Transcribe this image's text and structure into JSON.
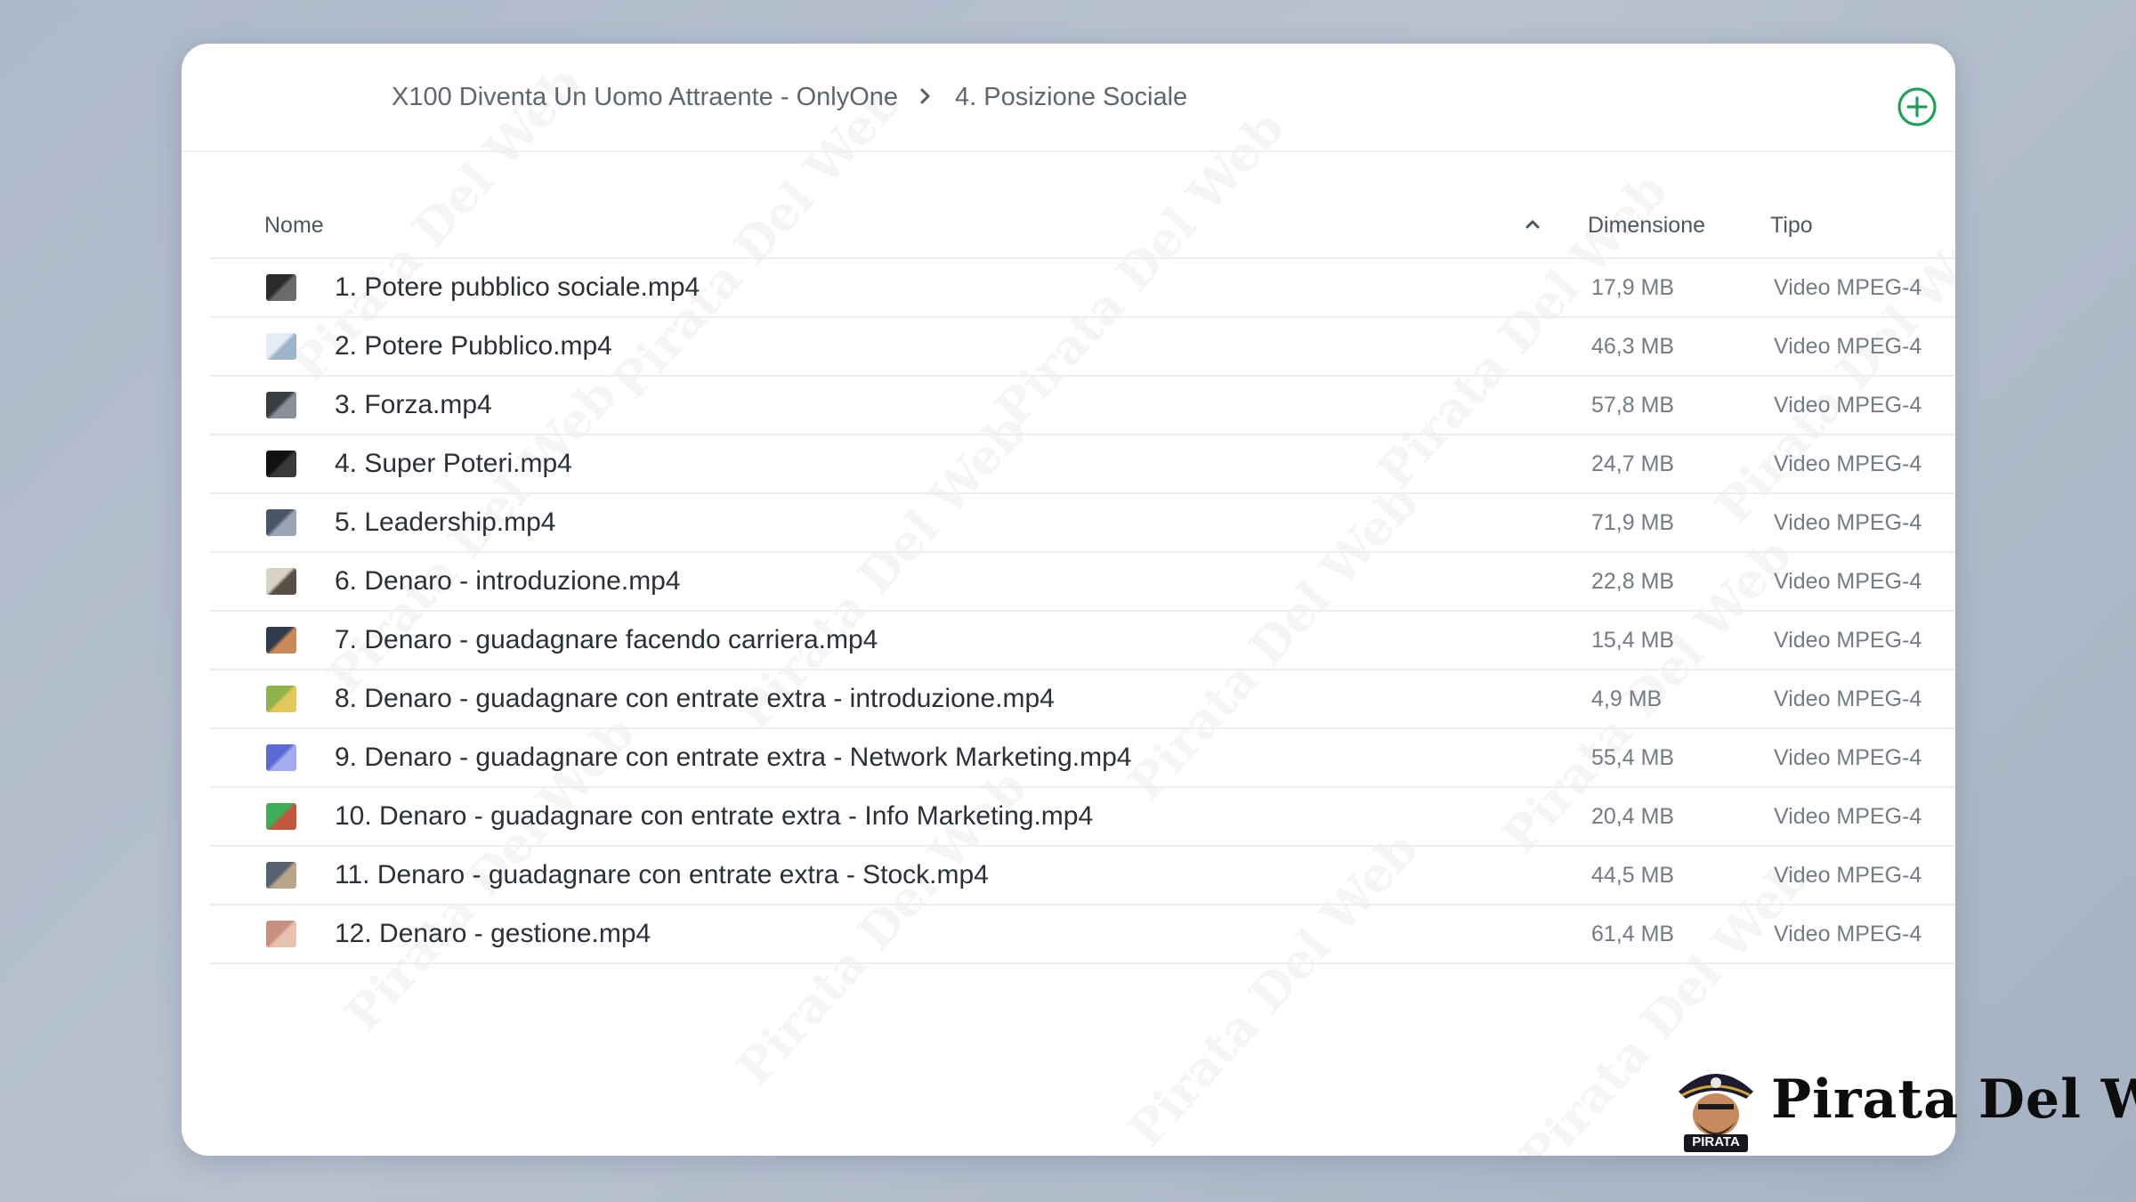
{
  "breadcrumb": {
    "parent": "X100 Diventa Un Uomo Attraente - OnlyOne",
    "current": "4. Posizione Sociale"
  },
  "columns": {
    "name": "Nome",
    "size": "Dimensione",
    "type": "Tipo"
  },
  "files": [
    {
      "name": "1. Potere pubblico sociale.mp4",
      "size": "17,9 MB",
      "type": "Video MPEG-4",
      "thumb": [
        "#2b2b2b",
        "#6b6b6b"
      ]
    },
    {
      "name": "2. Potere Pubblico.mp4",
      "size": "46,3 MB",
      "type": "Video MPEG-4",
      "thumb": [
        "#e4ecf5",
        "#9fb3c8"
      ]
    },
    {
      "name": "3. Forza.mp4",
      "size": "57,8 MB",
      "type": "Video MPEG-4",
      "thumb": [
        "#3a3d42",
        "#8a9099"
      ]
    },
    {
      "name": "4. Super Poteri.mp4",
      "size": "24,7 MB",
      "type": "Video MPEG-4",
      "thumb": [
        "#111111",
        "#3a3a3a"
      ]
    },
    {
      "name": "5. Leadership.mp4",
      "size": "71,9 MB",
      "type": "Video MPEG-4",
      "thumb": [
        "#4a5566",
        "#9aa6b5"
      ]
    },
    {
      "name": "6. Denaro - introduzione.mp4",
      "size": "22,8 MB",
      "type": "Video MPEG-4",
      "thumb": [
        "#d9d2c6",
        "#5b4e44"
      ]
    },
    {
      "name": "7. Denaro - guadagnare facendo carriera.mp4",
      "size": "15,4 MB",
      "type": "Video MPEG-4",
      "thumb": [
        "#2f3a4a",
        "#c98a5a"
      ]
    },
    {
      "name": "8. Denaro - guadagnare con entrate extra - introduzione.mp4",
      "size": "4,9 MB",
      "type": "Video MPEG-4",
      "thumb": [
        "#8fb24a",
        "#e2c85c"
      ]
    },
    {
      "name": "9. Denaro - guadagnare con entrate extra - Network Marketing.mp4",
      "size": "55,4 MB",
      "type": "Video MPEG-4",
      "thumb": [
        "#5d6ad6",
        "#a3acef"
      ]
    },
    {
      "name": "10. Denaro - guadagnare con entrate extra - Info Marketing.mp4",
      "size": "20,4 MB",
      "type": "Video MPEG-4",
      "thumb": [
        "#3fae5a",
        "#c2573f"
      ]
    },
    {
      "name": "11. Denaro - guadagnare con entrate extra - Stock.mp4",
      "size": "44,5 MB",
      "type": "Video MPEG-4",
      "thumb": [
        "#56606e",
        "#b9a58c"
      ]
    },
    {
      "name": "12. Denaro - gestione.mp4",
      "size": "61,4 MB",
      "type": "Video MPEG-4",
      "thumb": [
        "#c98f7d",
        "#e8c2b0"
      ]
    }
  ],
  "watermark": "Pirata Del Web",
  "brand": {
    "name": "Pirata Del Web",
    "badge": "PIRATA"
  },
  "colors": {
    "accent": "#21a05a",
    "background": "#b1bccb"
  },
  "icons": {
    "add": "plus-circle-icon",
    "sort": "chevron-up-icon",
    "separator": "chevron-right-icon"
  }
}
